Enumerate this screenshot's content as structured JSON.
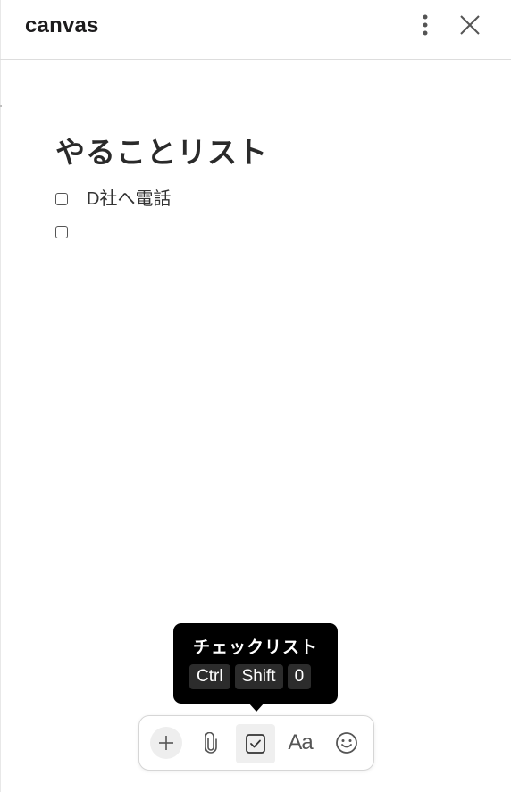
{
  "header": {
    "title": "canvas",
    "menu_icon": "vertical-dots-icon",
    "close_icon": "close-icon"
  },
  "document": {
    "heading": "やることリスト",
    "checklist": [
      {
        "label": "D社へ電話",
        "checked": false
      },
      {
        "label": "",
        "checked": false
      }
    ]
  },
  "tooltip": {
    "title": "チェックリスト",
    "keys": [
      "Ctrl",
      "Shift",
      "0"
    ]
  },
  "toolbar": {
    "text_format_label": "Aa",
    "buttons": [
      "plus-icon",
      "paperclip-icon",
      "checklist-icon",
      "text-format-icon",
      "emoji-icon"
    ]
  },
  "colors": {
    "text": "#1d1c1d",
    "tooltip_bg": "#000000",
    "divider": "#dddddd"
  }
}
